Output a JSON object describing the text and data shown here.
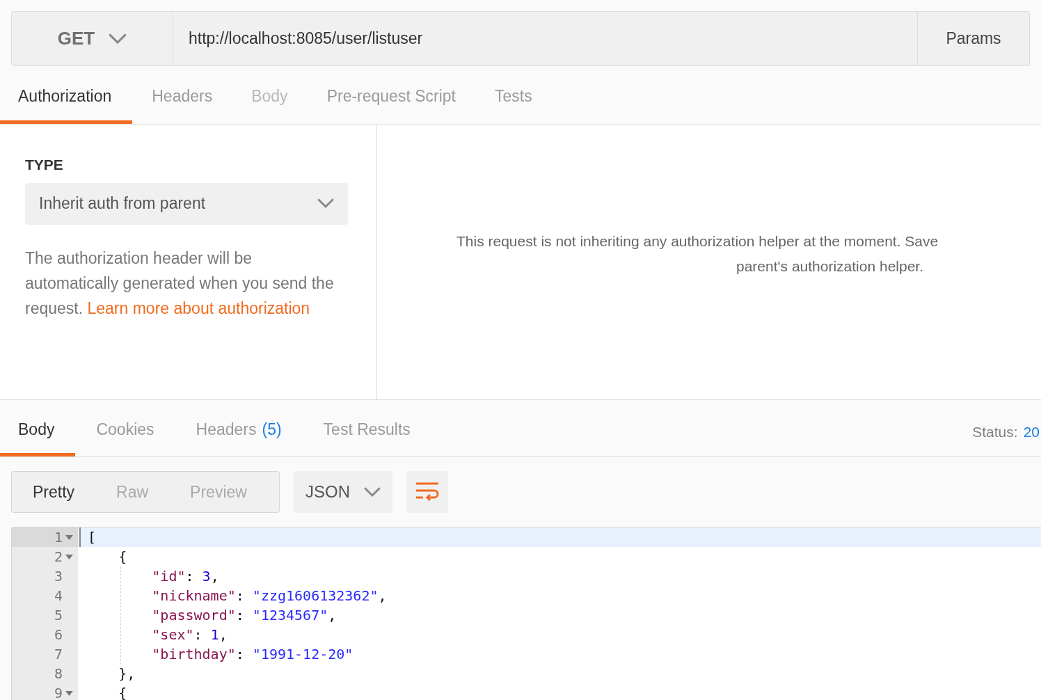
{
  "request": {
    "method": "GET",
    "url": "http://localhost:8085/user/listuser",
    "params_button": "Params"
  },
  "request_tabs": [
    {
      "label": "Authorization",
      "selected": true,
      "disabled": false
    },
    {
      "label": "Headers",
      "selected": false,
      "disabled": false
    },
    {
      "label": "Body",
      "selected": false,
      "disabled": true
    },
    {
      "label": "Pre-request Script",
      "selected": false,
      "disabled": false
    },
    {
      "label": "Tests",
      "selected": false,
      "disabled": false
    }
  ],
  "auth": {
    "type_label": "TYPE",
    "type_value": "Inherit auth from parent",
    "description": "The authorization header will be automatically generated when you send the request.",
    "link": "Learn more about authorization"
  },
  "auth_message": [
    "This request is not inheriting any authorization helper at the moment. Save",
    "parent's authorization helper."
  ],
  "response_tabs": [
    {
      "label": "Body",
      "selected": true
    },
    {
      "label": "Cookies",
      "selected": false
    },
    {
      "label": "Headers",
      "count": "(5)",
      "selected": false
    },
    {
      "label": "Test Results",
      "selected": false
    }
  ],
  "status": {
    "label": "Status:",
    "value": "20"
  },
  "view_modes": [
    {
      "label": "Pretty",
      "selected": true
    },
    {
      "label": "Raw",
      "selected": false
    },
    {
      "label": "Preview",
      "selected": false
    }
  ],
  "language": "JSON",
  "code_lines": [
    {
      "number": "1",
      "foldable": true,
      "active": true,
      "tokens": [
        {
          "kind": "punct",
          "text": "["
        }
      ]
    },
    {
      "number": "2",
      "foldable": true,
      "active": false,
      "tokens": [
        {
          "kind": "punct",
          "text": "    {"
        }
      ]
    },
    {
      "number": "3",
      "foldable": false,
      "active": false,
      "tokens": [
        {
          "kind": "key",
          "text": "        \"id\""
        },
        {
          "kind": "punct",
          "text": ": "
        },
        {
          "kind": "number",
          "text": "3"
        },
        {
          "kind": "punct",
          "text": ","
        }
      ]
    },
    {
      "number": "4",
      "foldable": false,
      "active": false,
      "tokens": [
        {
          "kind": "key",
          "text": "        \"nickname\""
        },
        {
          "kind": "punct",
          "text": ": "
        },
        {
          "kind": "string",
          "text": "\"zzg1606132362\""
        },
        {
          "kind": "punct",
          "text": ","
        }
      ]
    },
    {
      "number": "5",
      "foldable": false,
      "active": false,
      "tokens": [
        {
          "kind": "key",
          "text": "        \"password\""
        },
        {
          "kind": "punct",
          "text": ": "
        },
        {
          "kind": "string",
          "text": "\"1234567\""
        },
        {
          "kind": "punct",
          "text": ","
        }
      ]
    },
    {
      "number": "6",
      "foldable": false,
      "active": false,
      "tokens": [
        {
          "kind": "key",
          "text": "        \"sex\""
        },
        {
          "kind": "punct",
          "text": ": "
        },
        {
          "kind": "number",
          "text": "1"
        },
        {
          "kind": "punct",
          "text": ","
        }
      ]
    },
    {
      "number": "7",
      "foldable": false,
      "active": false,
      "tokens": [
        {
          "kind": "key",
          "text": "        \"birthday\""
        },
        {
          "kind": "punct",
          "text": ": "
        },
        {
          "kind": "string",
          "text": "\"1991-12-20\""
        }
      ]
    },
    {
      "number": "8",
      "foldable": false,
      "active": false,
      "tokens": [
        {
          "kind": "punct",
          "text": "    },"
        }
      ]
    },
    {
      "number": "9",
      "foldable": true,
      "active": false,
      "tokens": [
        {
          "kind": "punct",
          "text": "    {"
        }
      ]
    }
  ]
}
